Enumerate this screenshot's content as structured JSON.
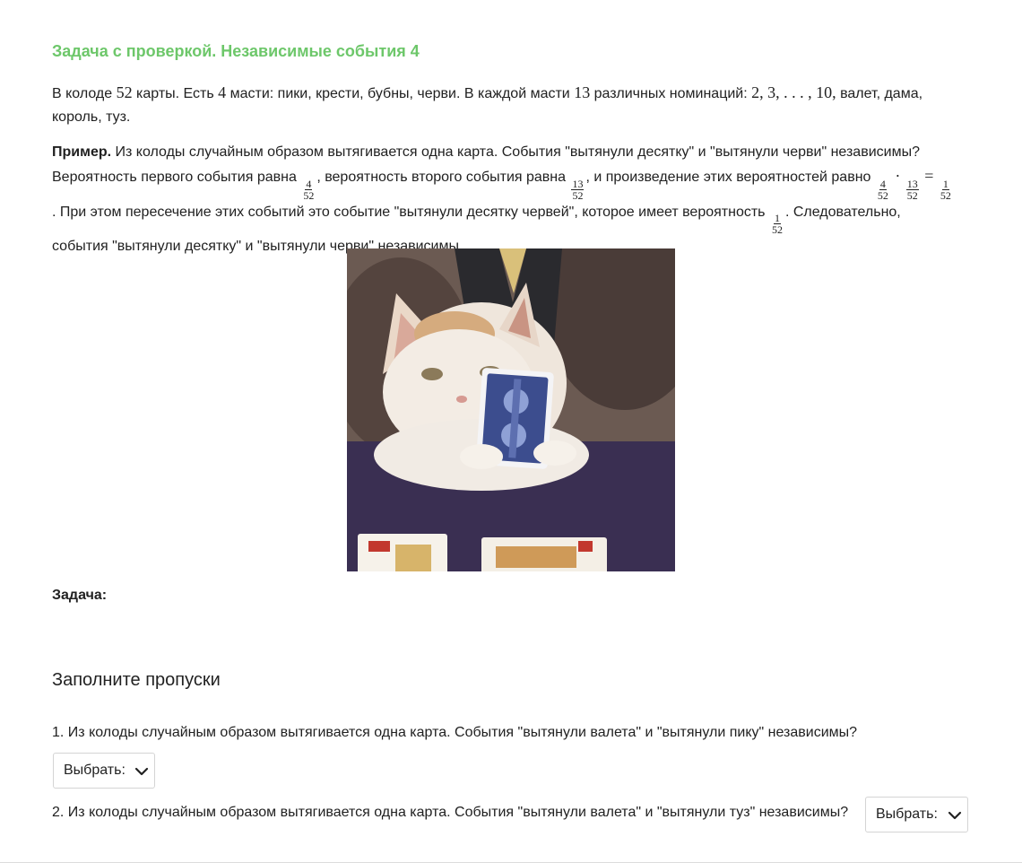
{
  "header": {
    "title": "Задача с проверкой. Независимые события 4"
  },
  "intro": {
    "t1": "В колоде ",
    "m1": "52",
    "t2": " карты. Есть ",
    "m2": "4",
    "t3": " масти: пики, крести, бубны, черви. В каждой масти ",
    "m3": "13",
    "t4": " различных номинаций: ",
    "m4": "2, 3, . . . , 10,",
    "t5": " валет, дама, король, туз."
  },
  "example": {
    "bold": "Пример.",
    "t1": " Из колоды случайным образом вытягивается одна карта. События \"вытянули десятку\" и \"вытянули черви\" независимы? Вероятность первого события равна ",
    "f1": {
      "num": "4",
      "den": "52"
    },
    "t2": ", вероятность второго события равна ",
    "f2": {
      "num": "13",
      "den": "52"
    },
    "t3": ", и произведение этих вероятностей равно ",
    "f3": {
      "num": "4",
      "den": "52"
    },
    "dot": "·",
    "f4": {
      "num": "13",
      "den": "52"
    },
    "eq": "=",
    "f5": {
      "num": "1",
      "den": "52"
    },
    "t4": ". При этом пересечение этих событий это событие \"вытянули десятку червей\", которое имеет вероятность ",
    "f6": {
      "num": "1",
      "den": "52"
    },
    "t5": ". Следовательно, события \"вытянули десятку\" и \"вытянули черви\" независимы."
  },
  "image": {
    "icon": "cat-holding-cards-photo"
  },
  "task": {
    "label": "Задача:"
  },
  "fill": {
    "heading": "Заполните пропуски"
  },
  "questions": [
    {
      "text": "1. Из колоды случайным образом вытягивается одна карта. События \"вытянули валета\" и \"вытянули пику\" независимы?",
      "select": "Выбрать:"
    },
    {
      "text": "2. Из колоды случайным образом вытягивается одна карта. События \"вытянули валета\" и \"вытянули туз\" независимы?",
      "select": "Выбрать:"
    }
  ],
  "colors": {
    "title": "#6dc76a",
    "text": "#212121",
    "border": "#d4d4d4"
  }
}
